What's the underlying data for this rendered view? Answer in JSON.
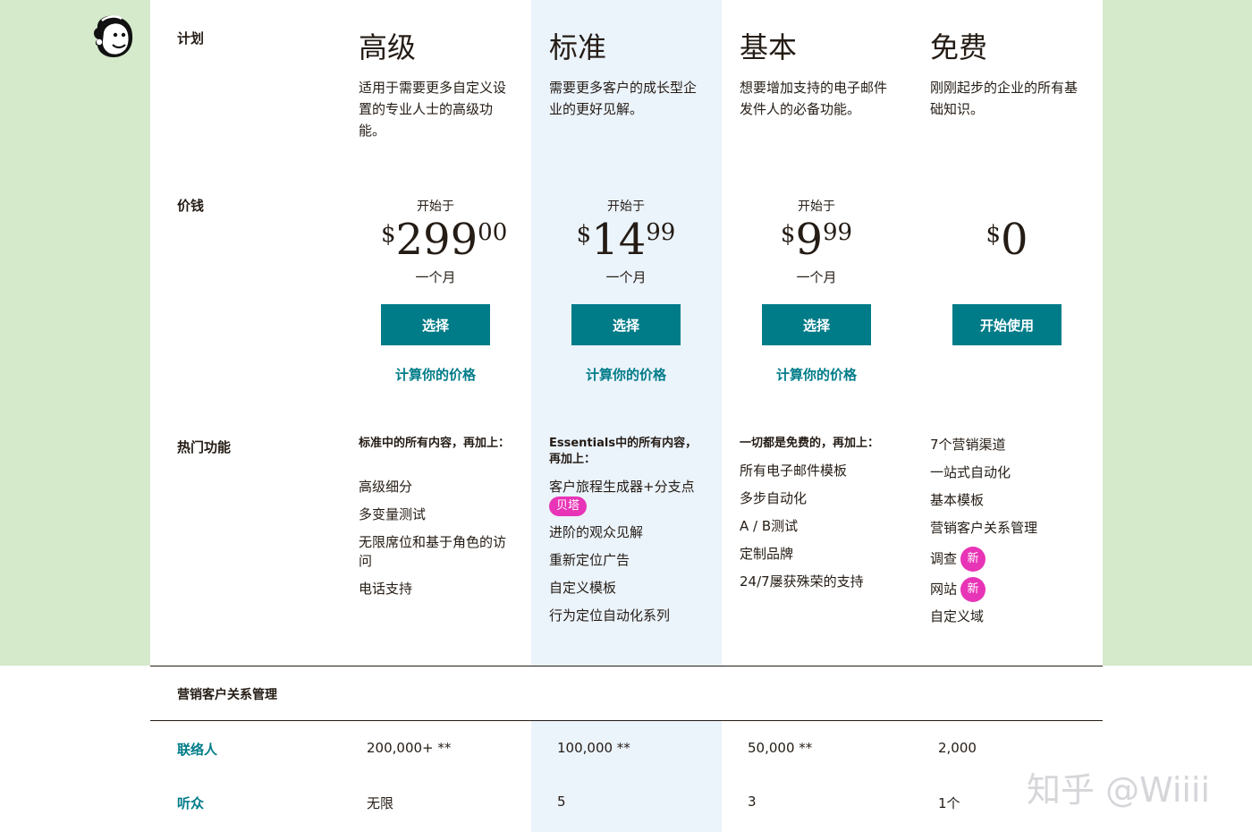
{
  "row_labels": {
    "plan": "计划",
    "price": "价钱",
    "features": "热门功能"
  },
  "plans": [
    {
      "name": "高级",
      "desc": "适用于需要更多自定义设置的专业人士的高级功能。",
      "starts": "开始于",
      "currency": "$",
      "price_int": "299",
      "price_dec": "00",
      "per": "一个月",
      "button": "选择",
      "calc": "计算你的价格",
      "feat_head": "标准中的所有内容，再加上：",
      "features": [
        "高级细分",
        "多变量测试",
        "无限席位和基于角色的访问",
        "电话支持"
      ]
    },
    {
      "name": "标准",
      "desc": "需要更多客户的成长型企业的更好见解。",
      "starts": "开始于",
      "currency": "$",
      "price_int": "14",
      "price_dec": "99",
      "per": "一个月",
      "button": "选择",
      "calc": "计算你的价格",
      "feat_head": "Essentials中的所有内容，再加上：",
      "features": [
        "客户旅程生成器+分支点",
        "进阶的观众见解",
        "重新定位广告",
        "自定义模板",
        "行为定位自动化系列"
      ],
      "badge": "贝塔"
    },
    {
      "name": "基本",
      "desc": "想要增加支持的电子邮件发件人的必备功能。",
      "starts": "开始于",
      "currency": "$",
      "price_int": "9",
      "price_dec": "99",
      "per": "一个月",
      "button": "选择",
      "calc": "计算你的价格",
      "feat_head": "一切都是免费的，再加上：",
      "features": [
        "所有电子邮件模板",
        "多步自动化",
        "A / B测试",
        "定制品牌",
        "24/7屡获殊荣的支持"
      ]
    },
    {
      "name": "免费",
      "desc": "刚刚起步的企业的所有基础知识。",
      "currency": "$",
      "price_int": "0",
      "button": "开始使用",
      "features": [
        "7个营销渠道",
        "一站式自动化",
        "基本模板",
        "营销客户关系管理",
        "调查",
        "网站",
        "自定义域"
      ],
      "new_badge": "新"
    }
  ],
  "crm": {
    "section_title": "营销客户关系管理",
    "rows": [
      {
        "label": "联络人",
        "values": [
          "200,000+ **",
          "100,000 **",
          "50,000 **",
          "2,000"
        ]
      },
      {
        "label": "听众",
        "values": [
          "无限",
          "5",
          "3",
          "1个"
        ]
      }
    ]
  },
  "watermark": "知乎 @Wiiii",
  "colors": {
    "teal": "#007c89",
    "green_bg": "#d5e9cb",
    "highlight": "#ebf3fb",
    "badge": "#e834b6"
  }
}
